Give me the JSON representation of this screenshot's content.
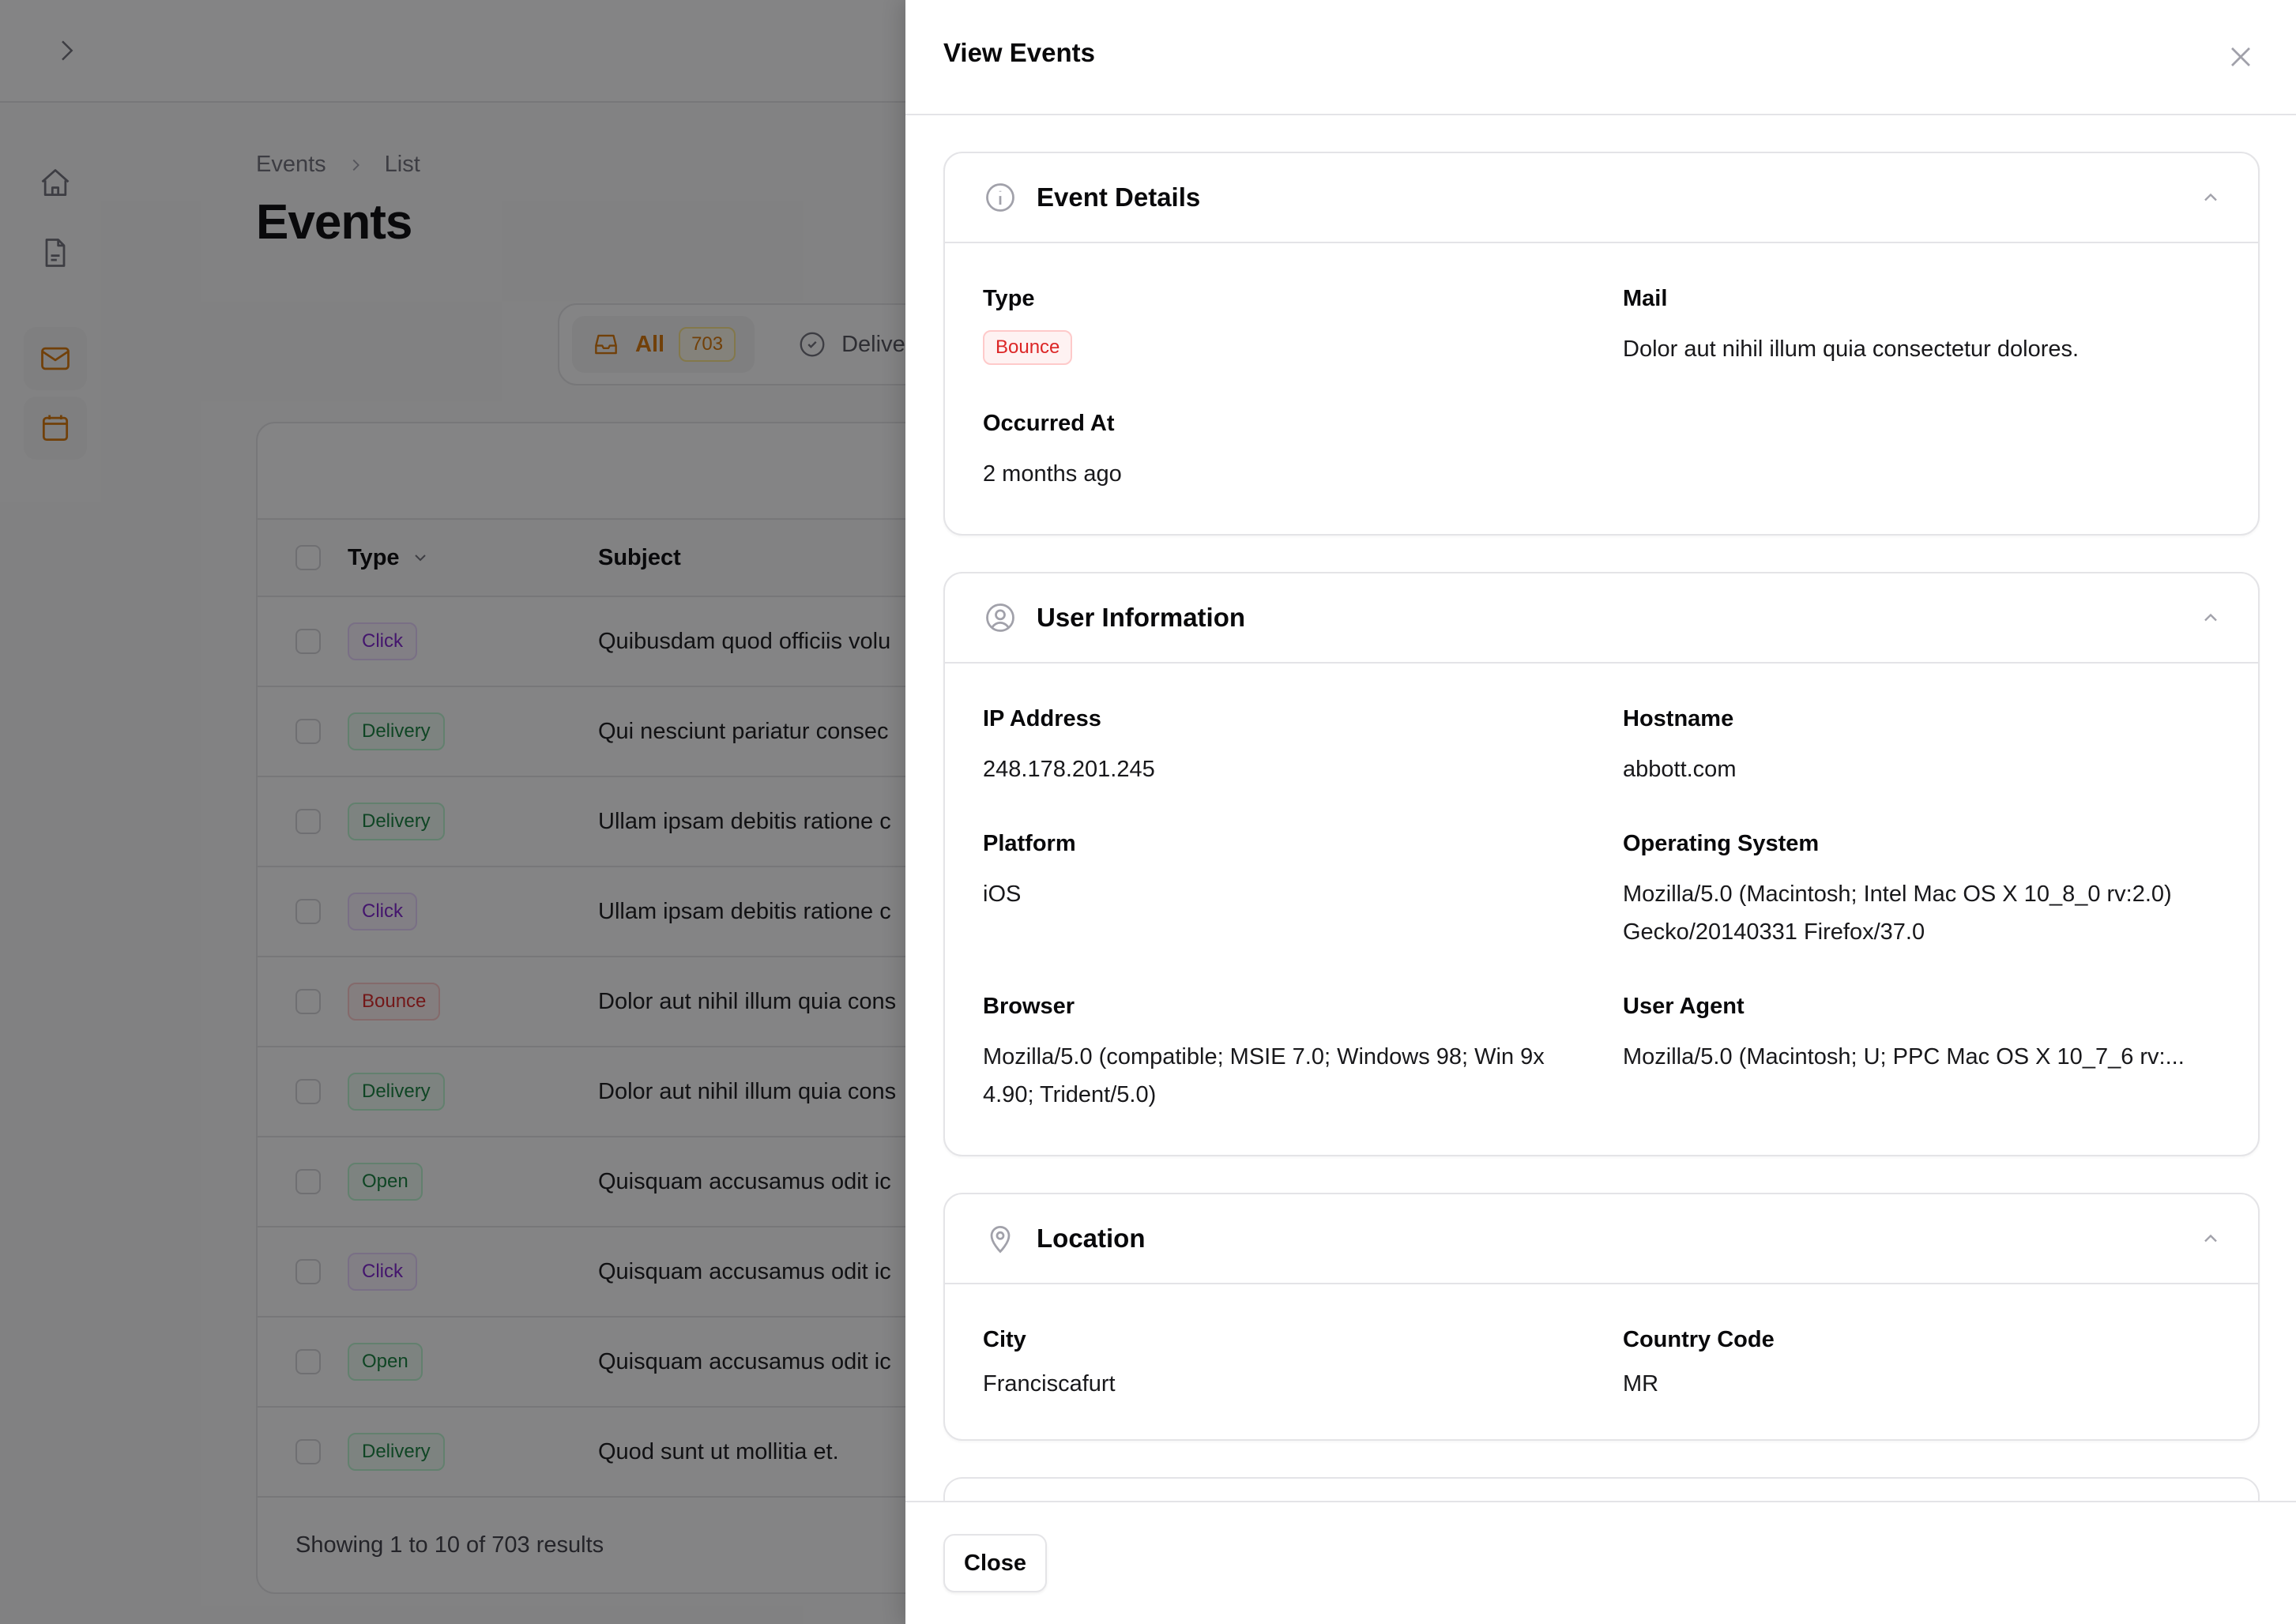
{
  "app": {
    "breadcrumb": [
      "Events",
      "List"
    ],
    "page_title": "Events",
    "sidebar": [
      {
        "icon": "home-icon",
        "active": false
      },
      {
        "icon": "document-icon",
        "active": false
      },
      {
        "icon": "mail-icon",
        "active": true
      },
      {
        "icon": "calendar-icon",
        "active": true
      }
    ],
    "tabs": [
      {
        "label": "All",
        "count": "703",
        "icon": "inbox-icon",
        "active": true
      },
      {
        "label": "Delivery",
        "icon": "check-circle-icon",
        "active": false
      }
    ],
    "table": {
      "columns": [
        "Type",
        "Subject"
      ],
      "rows": [
        {
          "type": "Click",
          "kind": "click",
          "subject": "Quibusdam quod officiis volu"
        },
        {
          "type": "Delivery",
          "kind": "delivery",
          "subject": "Qui nesciunt pariatur consec"
        },
        {
          "type": "Delivery",
          "kind": "delivery",
          "subject": "Ullam ipsam debitis ratione c"
        },
        {
          "type": "Click",
          "kind": "click",
          "subject": "Ullam ipsam debitis ratione c"
        },
        {
          "type": "Bounce",
          "kind": "bounce",
          "subject": "Dolor aut nihil illum quia cons"
        },
        {
          "type": "Delivery",
          "kind": "delivery",
          "subject": "Dolor aut nihil illum quia cons"
        },
        {
          "type": "Open",
          "kind": "open",
          "subject": "Quisquam accusamus odit ic"
        },
        {
          "type": "Click",
          "kind": "click",
          "subject": "Quisquam accusamus odit ic"
        },
        {
          "type": "Open",
          "kind": "open",
          "subject": "Quisquam accusamus odit ic"
        },
        {
          "type": "Delivery",
          "kind": "delivery",
          "subject": "Quod sunt ut mollitia et."
        }
      ],
      "footer": "Showing 1 to 10 of 703 results"
    }
  },
  "modal": {
    "title": "View Events",
    "close_label": "Close",
    "sections": {
      "event": {
        "title": "Event Details",
        "type_label": "Type",
        "type_value": "Bounce",
        "mail_label": "Mail",
        "mail_value": "Dolor aut nihil illum quia consectetur dolores.",
        "occurred_label": "Occurred At",
        "occurred_value": "2 months ago"
      },
      "user": {
        "title": "User Information",
        "ip_label": "IP Address",
        "ip_value": "248.178.201.245",
        "hostname_label": "Hostname",
        "hostname_value": "abbott.com",
        "platform_label": "Platform",
        "platform_value": "iOS",
        "os_label": "Operating System",
        "os_value": "Mozilla/5.0 (Macintosh; Intel Mac OS X 10_8_0 rv:2.0) Gecko/20140331 Firefox/37.0",
        "browser_label": "Browser",
        "browser_value": "Mozilla/5.0 (compatible; MSIE 7.0; Windows 98; Win 9x 4.90; Trident/5.0)",
        "ua_label": "User Agent",
        "ua_value": "Mozilla/5.0 (Macintosh; U; PPC Mac OS X 10_7_6 rv:..."
      },
      "location": {
        "title": "Location",
        "city_label": "City",
        "city_value": "Franciscafurt",
        "country_label": "Country Code",
        "country_value": "MR"
      }
    }
  },
  "colors": {
    "accent": "#d97706",
    "bounce": "#dc2626",
    "click": "#7e22ce",
    "delivery": "#15803d"
  }
}
